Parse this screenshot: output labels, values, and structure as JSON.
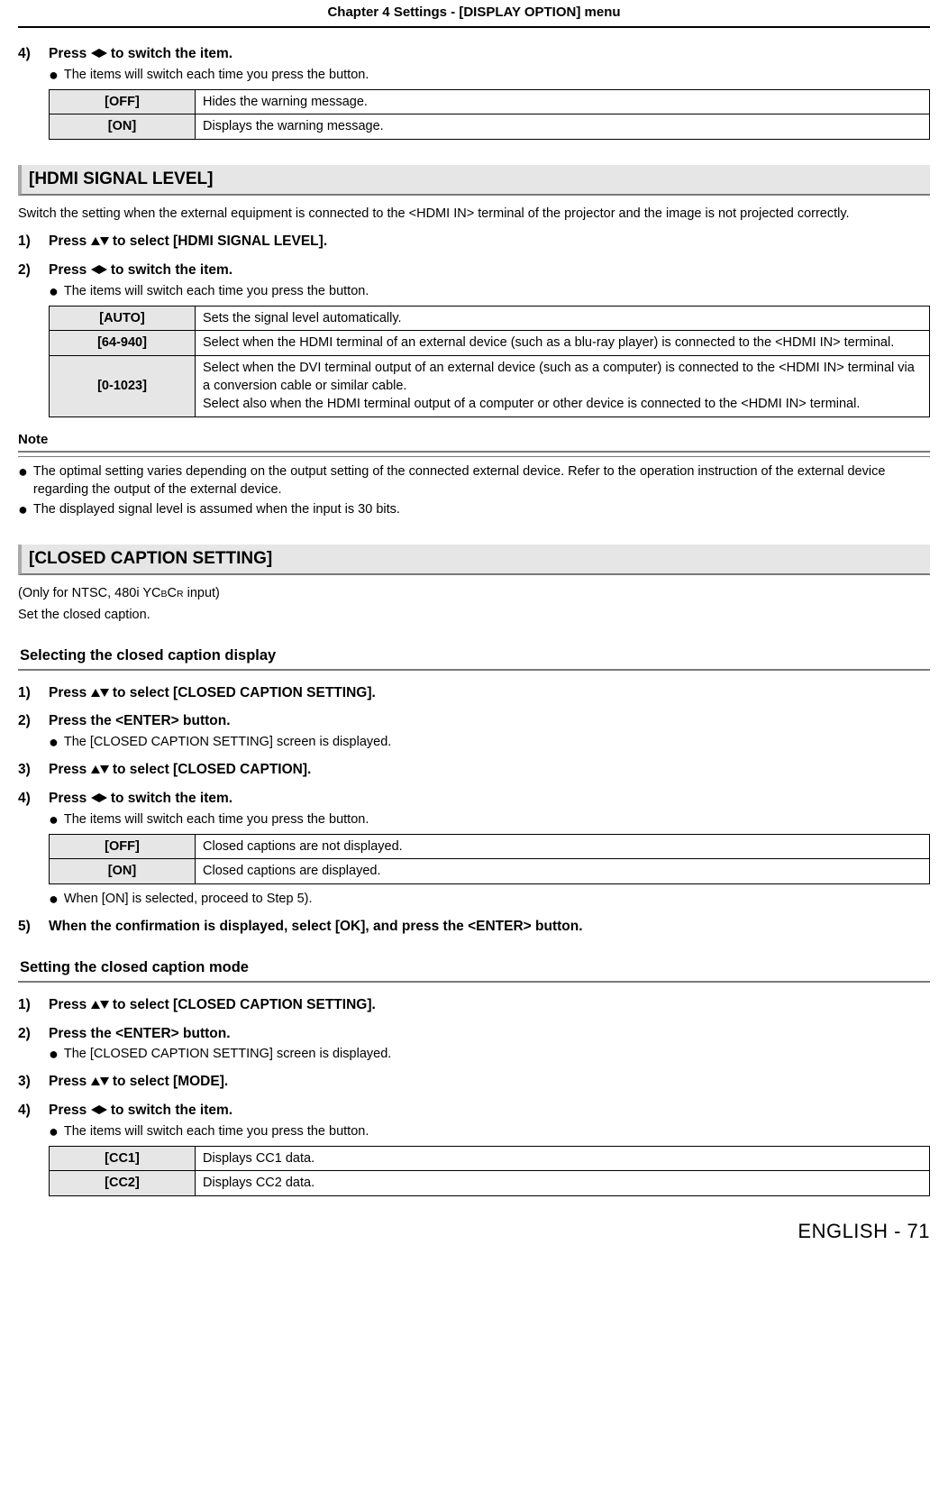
{
  "chapter_header": "Chapter 4   Settings - [DISPLAY OPTION] menu",
  "step4a": {
    "num": "4)",
    "text_before": "Press ",
    "text_after": " to switch the item.",
    "bullet": "The items will switch each time you press the button."
  },
  "table1": {
    "rows": [
      {
        "label": "[OFF]",
        "desc": "Hides the warning message."
      },
      {
        "label": "[ON]",
        "desc": "Displays the warning message."
      }
    ]
  },
  "hdmi_section": {
    "title": "[HDMI SIGNAL LEVEL]",
    "intro": "Switch the setting when the external equipment is connected to the <HDMI IN> terminal of the projector and the image is not projected correctly.",
    "step1": {
      "num": "1)",
      "before": "Press ",
      "after": " to select [HDMI SIGNAL LEVEL]."
    },
    "step2": {
      "num": "2)",
      "before": "Press ",
      "after": " to switch the item.",
      "bullet": "The items will switch each time you press the button."
    },
    "table": {
      "rows": [
        {
          "label": "[AUTO]",
          "desc": "Sets the signal level automatically."
        },
        {
          "label": "[64-940]",
          "desc": "Select when the HDMI terminal of an external device (such as a blu-ray player) is connected to the <HDMI IN> terminal."
        },
        {
          "label": "[0-1023]",
          "desc": "Select when the DVI terminal output of an external device (such as a computer) is connected to the <HDMI IN> terminal via a conversion cable or similar cable.\nSelect also when the HDMI terminal output of a computer or other device is connected to the <HDMI IN> terminal."
        }
      ]
    },
    "note_label": "Note",
    "notes": [
      "The optimal setting varies depending on the output setting of the connected external device. Refer to the operation instruction of the external device regarding the output of the external device.",
      "The displayed signal level is assumed when the input is 30 bits."
    ]
  },
  "cc_section": {
    "title": "[CLOSED CAPTION SETTING]",
    "subtitle_line1_pre": "(Only for NTSC, 480i YC",
    "subtitle_line1_sub1": "B",
    "subtitle_line1_mid": "C",
    "subtitle_line1_sub2": "R",
    "subtitle_line1_post": " input)",
    "subtitle_line2": "Set the closed caption.",
    "sub1_title": "Selecting the closed caption display",
    "s1_step1": {
      "num": "1)",
      "before": "Press ",
      "after": " to select [CLOSED CAPTION SETTING]."
    },
    "s1_step2": {
      "num": "2)",
      "text": "Press the <ENTER> button.",
      "bullet": "The [CLOSED CAPTION SETTING] screen is displayed."
    },
    "s1_step3": {
      "num": "3)",
      "before": "Press ",
      "after": " to select [CLOSED CAPTION]."
    },
    "s1_step4": {
      "num": "4)",
      "before": "Press ",
      "after": " to switch the item.",
      "bullet": "The items will switch each time you press the button."
    },
    "s1_table": {
      "rows": [
        {
          "label": "[OFF]",
          "desc": "Closed captions are not displayed."
        },
        {
          "label": "[ON]",
          "desc": "Closed captions are displayed."
        }
      ]
    },
    "s1_bullet_after": "When [ON] is selected, proceed to Step 5).",
    "s1_step5": {
      "num": "5)",
      "text": "When the confirmation is displayed, select [OK], and press the <ENTER> button."
    },
    "sub2_title": "Setting the closed caption mode",
    "s2_step1": {
      "num": "1)",
      "before": "Press ",
      "after": " to select [CLOSED CAPTION SETTING]."
    },
    "s2_step2": {
      "num": "2)",
      "text": "Press the <ENTER> button.",
      "bullet": "The [CLOSED CAPTION SETTING] screen is displayed."
    },
    "s2_step3": {
      "num": "3)",
      "before": "Press ",
      "after": " to select [MODE]."
    },
    "s2_step4": {
      "num": "4)",
      "before": "Press ",
      "after": " to switch the item.",
      "bullet": "The items will switch each time you press the button."
    },
    "s2_table": {
      "rows": [
        {
          "label": "[CC1]",
          "desc": "Displays CC1 data."
        },
        {
          "label": "[CC2]",
          "desc": "Displays CC2 data."
        }
      ]
    }
  },
  "footer": "ENGLISH - 71"
}
